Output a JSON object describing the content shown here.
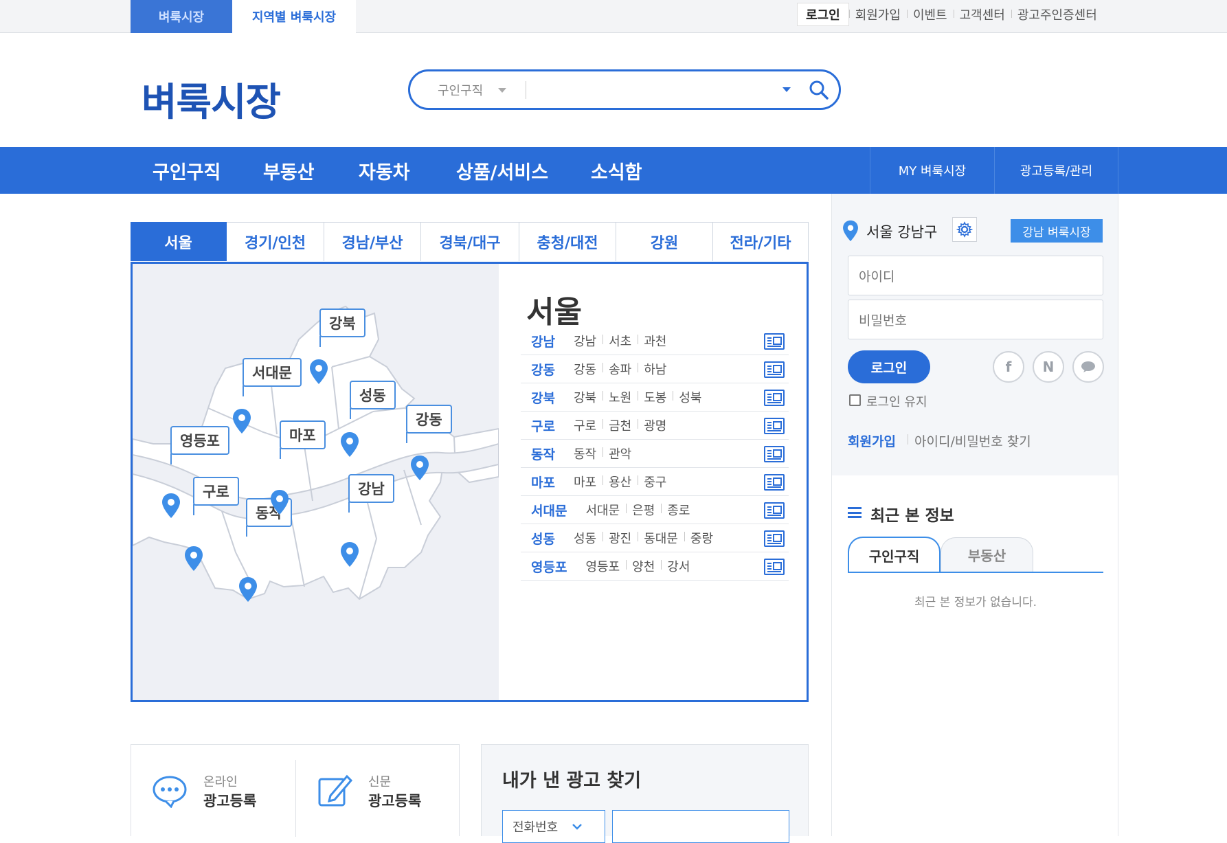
{
  "topbar": {
    "tabs": [
      "벼룩시장",
      "지역별 벼룩시장"
    ],
    "links": [
      "로그인",
      "회원가입",
      "이벤트",
      "고객센터",
      "광고주인증센터"
    ]
  },
  "header": {
    "logo": "벼룩시장",
    "search": {
      "category": "구인구직",
      "value": ""
    }
  },
  "nav": {
    "items": [
      "구인구직",
      "부동산",
      "자동차",
      "상품/서비스",
      "소식함"
    ],
    "right": [
      "MY 벼룩시장",
      "광고등록/관리"
    ]
  },
  "region_tabs": [
    "서울",
    "경기/인천",
    "경남/부산",
    "경북/대구",
    "충청/대전",
    "강원",
    "전라/기타"
  ],
  "map": {
    "labels": [
      "강북",
      "서대문",
      "성동",
      "강동",
      "영등포",
      "마포",
      "구로",
      "강남",
      "동작"
    ]
  },
  "region": {
    "title": "서울",
    "districts": [
      {
        "name": "강남",
        "subs": [
          "강남",
          "서초",
          "과천"
        ]
      },
      {
        "name": "강동",
        "subs": [
          "강동",
          "송파",
          "하남"
        ]
      },
      {
        "name": "강북",
        "subs": [
          "강북",
          "노원",
          "도봉",
          "성북"
        ]
      },
      {
        "name": "구로",
        "subs": [
          "구로",
          "금천",
          "광명"
        ]
      },
      {
        "name": "동작",
        "subs": [
          "동작",
          "관악"
        ]
      },
      {
        "name": "마포",
        "subs": [
          "마포",
          "용산",
          "중구"
        ]
      },
      {
        "name": "서대문",
        "subs": [
          "서대문",
          "은평",
          "종로"
        ]
      },
      {
        "name": "성동",
        "subs": [
          "성동",
          "광진",
          "동대문",
          "중랑"
        ]
      },
      {
        "name": "영등포",
        "subs": [
          "영등포",
          "양천",
          "강서"
        ]
      }
    ]
  },
  "sidebar": {
    "location": "서울 강남구",
    "market_badge": "강남 벼룩시장",
    "id_placeholder": "아이디",
    "pw_placeholder": "비밀번호",
    "login_button": "로그인",
    "keep_login": "로그인 유지",
    "signup": "회원가입",
    "find": "아이디/비밀번호 찾기",
    "recent_title": "최근 본 정보",
    "recent_tabs": [
      "구인구직",
      "부동산"
    ],
    "recent_empty": "최근 본 정보가 없습니다."
  },
  "bottom": {
    "online_small": "온라인",
    "online_big": "광고등록",
    "news_small": "신문",
    "news_big": "광고등록",
    "find_title": "내가 낸 광고 찾기",
    "find_select": "전화번호"
  },
  "colors": {
    "brand": "#2a6dd8",
    "logo": "#1e53b4",
    "pin": "#3d8ee8"
  }
}
